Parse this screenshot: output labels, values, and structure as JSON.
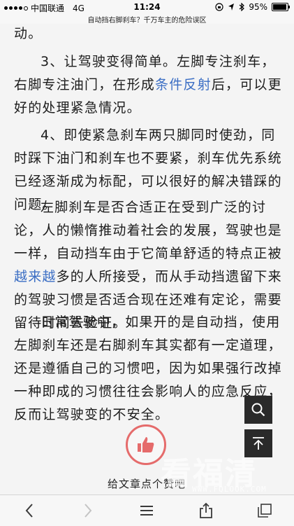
{
  "status_bar": {
    "carrier": "中国联通",
    "network": "4G",
    "time": "11:24",
    "battery_label": "95%",
    "battery_level": 0.95
  },
  "url_bar": {
    "title": "自动挡右脚刹车？千万车主的危险误区"
  },
  "article": {
    "p0": "动。",
    "p1_before": "3、让驾驶变得简单。左脚专注刹车，右脚专注油门，在形成",
    "p1_link": "条件反射",
    "p1_after": "后，可以更好的处理紧急情况。",
    "p2": "4、即使紧急刹车两只脚同时使劲，同时踩下油门和刹车也不要紧，刹车优先系统已经逐渐成为标配，可以很好的解决错踩的问题。",
    "p3_before": "左脚刹车是否合适正在受到广泛的讨论，人的懒惰推动着社会的发展，驾驶也是一样，自动挡车由于它简单舒适的特点正被",
    "p3_link": "越来越",
    "p3_after": "多的人所接受，而从手动挡遗留下来的驾驶习惯是否适合现在还难有定论，需要留待时间去验证。",
    "p4": "日常驾驶中，如果开的是自动挡，使用左脚刹车还是右脚刹车其实都有一定道理，还是遵循自己的习惯吧，因为如果强行改掉一种即成的习惯往往会影响人的应急反应，反而让驾驶变的不安全。"
  },
  "like": {
    "caption": "给文章点个赞吧"
  },
  "watermark": {
    "text": "看福清",
    "url": "WWW.FQLOOK.COM"
  },
  "colors": {
    "link": "#3b6ec4",
    "like_ring": "#e56b6b"
  }
}
